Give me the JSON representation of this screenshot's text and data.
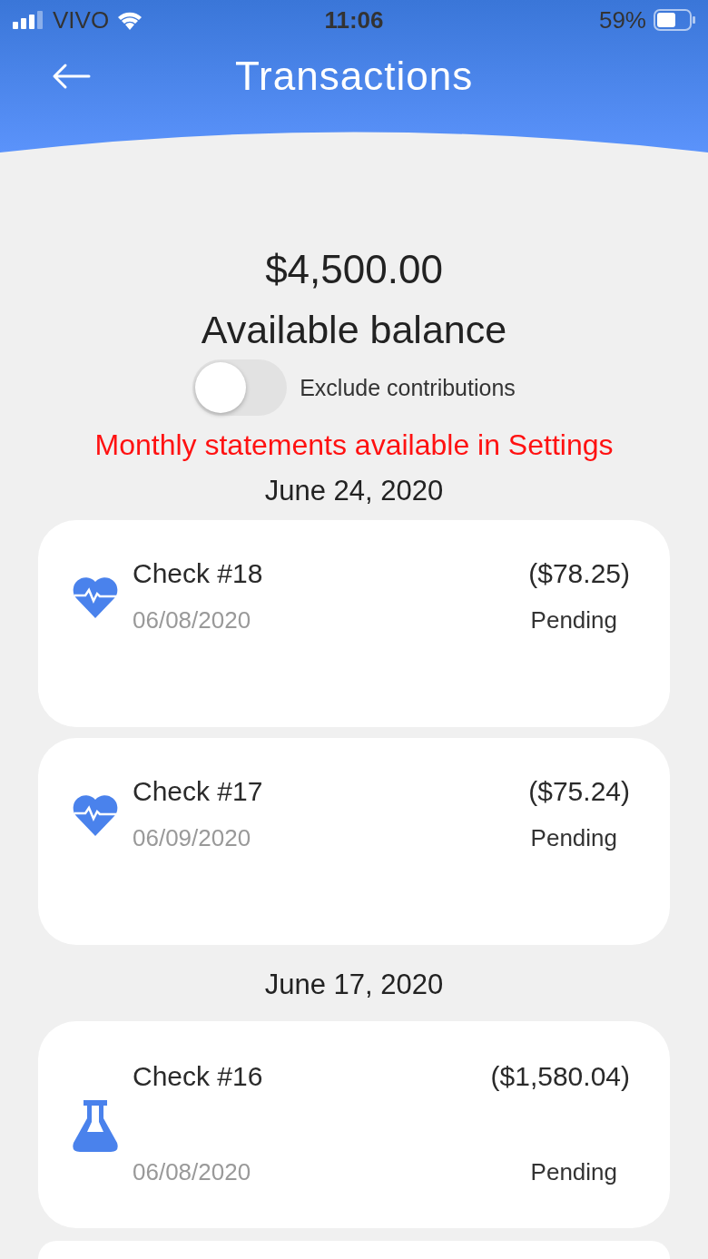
{
  "status_bar": {
    "carrier": "VIVO",
    "time": "11:06",
    "battery": "59%"
  },
  "header": {
    "title": "Transactions"
  },
  "balance": {
    "amount": "$4,500.00",
    "label": "Available balance"
  },
  "toggle": {
    "label": "Exclude contributions",
    "on": false
  },
  "notice": "Monthly statements available in Settings",
  "groups": [
    {
      "date": "June 24, 2020",
      "transactions": [
        {
          "kind": "heart",
          "title": "Check #18",
          "date": "06/08/2020",
          "amount": "($78.25)",
          "status": "Pending"
        },
        {
          "kind": "heart",
          "title": "Check #17",
          "date": "06/09/2020",
          "amount": "($75.24)",
          "status": "Pending"
        }
      ]
    },
    {
      "date": "June 17, 2020",
      "transactions": [
        {
          "kind": "flask",
          "title": "Check #16",
          "date": "06/08/2020",
          "amount": "($1,580.04)",
          "status": "Pending"
        }
      ]
    }
  ]
}
